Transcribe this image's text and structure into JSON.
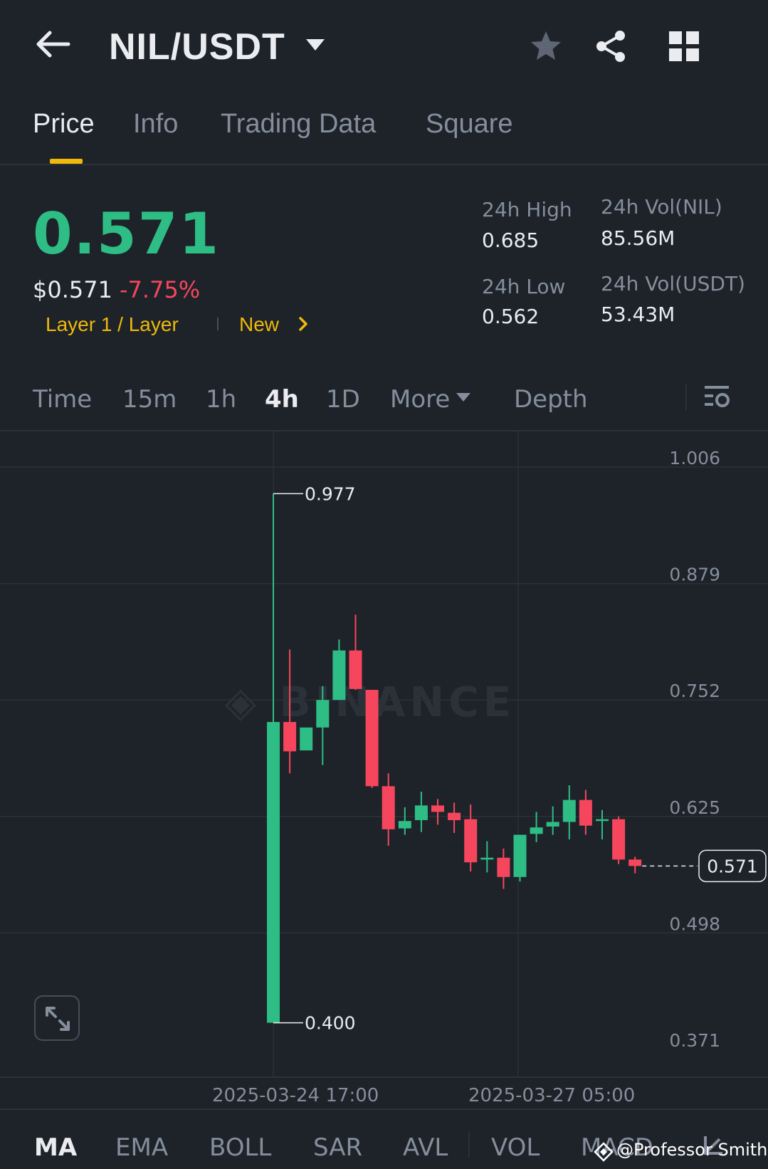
{
  "header": {
    "pair": "NIL/USDT"
  },
  "tabs": [
    {
      "label": "Price",
      "active": true
    },
    {
      "label": "Info",
      "active": false
    },
    {
      "label": "Trading Data",
      "active": false
    },
    {
      "label": "Square",
      "active": false
    }
  ],
  "ticker": {
    "last_price": "0.571",
    "usd_price": "$0.571",
    "change_pct": "-7.75%",
    "tag_category": "Layer 1 / Layer",
    "tag_new": "New",
    "high_label": "24h High",
    "high_value": "0.685",
    "low_label": "24h Low",
    "low_value": "0.562",
    "vol_base_label": "24h Vol(NIL)",
    "vol_base_value": "85.56M",
    "vol_quote_label": "24h Vol(USDT)",
    "vol_quote_value": "53.43M"
  },
  "intervals": {
    "time": "Time",
    "m15": "15m",
    "h1": "1h",
    "h4": "4h",
    "d1": "1D",
    "more": "More",
    "depth": "Depth",
    "active": "4h"
  },
  "indicators": {
    "ma": "MA",
    "ema": "EMA",
    "boll": "BOLL",
    "sar": "SAR",
    "avl": "AVL",
    "vol": "VOL",
    "macd": "MACD"
  },
  "watermark": {
    "user": "@Professor Smith"
  },
  "colors": {
    "up": "#2ebd85",
    "down": "#f6465d",
    "accent": "#f0b90b",
    "background": "#1e2329"
  },
  "chart_data": {
    "type": "candlestick",
    "y_ticks": [
      "1.006",
      "0.879",
      "0.752",
      "0.625",
      "0.498",
      "0.371"
    ],
    "ylim": [
      0.371,
      1.006
    ],
    "x_tick_labels": [
      "2025-03-24 17:00",
      "2025-03-27 05:00"
    ],
    "max_label": "0.977",
    "min_label": "0.400",
    "current_price_label": "0.571",
    "grid": true,
    "candles": [
      {
        "o": 0.4,
        "h": 0.977,
        "l": 0.4,
        "c": 0.728
      },
      {
        "o": 0.728,
        "h": 0.807,
        "l": 0.672,
        "c": 0.696
      },
      {
        "o": 0.697,
        "h": 0.715,
        "l": 0.697,
        "c": 0.722
      },
      {
        "o": 0.722,
        "h": 0.767,
        "l": 0.681,
        "c": 0.752
      },
      {
        "o": 0.752,
        "h": 0.818,
        "l": 0.752,
        "c": 0.806
      },
      {
        "o": 0.806,
        "h": 0.845,
        "l": 0.763,
        "c": 0.764
      },
      {
        "o": 0.763,
        "h": 0.763,
        "l": 0.656,
        "c": 0.658
      },
      {
        "o": 0.658,
        "h": 0.672,
        "l": 0.593,
        "c": 0.611
      },
      {
        "o": 0.612,
        "h": 0.635,
        "l": 0.605,
        "c": 0.62
      },
      {
        "o": 0.621,
        "h": 0.652,
        "l": 0.608,
        "c": 0.637
      },
      {
        "o": 0.637,
        "h": 0.644,
        "l": 0.616,
        "c": 0.63
      },
      {
        "o": 0.629,
        "h": 0.64,
        "l": 0.607,
        "c": 0.621
      },
      {
        "o": 0.622,
        "h": 0.638,
        "l": 0.565,
        "c": 0.575
      },
      {
        "o": 0.578,
        "h": 0.598,
        "l": 0.564,
        "c": 0.58
      },
      {
        "o": 0.58,
        "h": 0.59,
        "l": 0.546,
        "c": 0.559
      },
      {
        "o": 0.559,
        "h": 0.605,
        "l": 0.554,
        "c": 0.605
      },
      {
        "o": 0.606,
        "h": 0.63,
        "l": 0.597,
        "c": 0.613
      },
      {
        "o": 0.614,
        "h": 0.636,
        "l": 0.605,
        "c": 0.619
      },
      {
        "o": 0.619,
        "h": 0.659,
        "l": 0.6,
        "c": 0.643
      },
      {
        "o": 0.643,
        "h": 0.654,
        "l": 0.605,
        "c": 0.615
      },
      {
        "o": 0.62,
        "h": 0.632,
        "l": 0.6,
        "c": 0.622
      },
      {
        "o": 0.622,
        "h": 0.625,
        "l": 0.573,
        "c": 0.578
      },
      {
        "o": 0.578,
        "h": 0.581,
        "l": 0.563,
        "c": 0.571
      }
    ]
  }
}
